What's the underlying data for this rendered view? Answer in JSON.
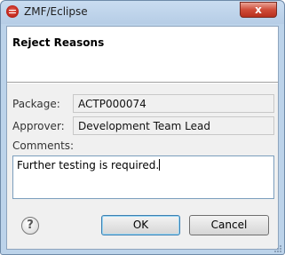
{
  "window": {
    "title": "ZMF/Eclipse",
    "close_label": "x"
  },
  "dialog": {
    "heading": "Reject Reasons",
    "package_label": "Package:",
    "package_value": "ACTP000074",
    "approver_label": "Approver:",
    "approver_value": "Development Team Lead",
    "comments_label": "Comments:",
    "comments_value": "Further testing is required."
  },
  "buttons": {
    "help": "?",
    "ok": "OK",
    "cancel": "Cancel"
  },
  "colors": {
    "frame": "#bcd3ea",
    "client": "#f0f0f0",
    "close": "#cf4c38",
    "default_button": "#3c7fb1"
  }
}
